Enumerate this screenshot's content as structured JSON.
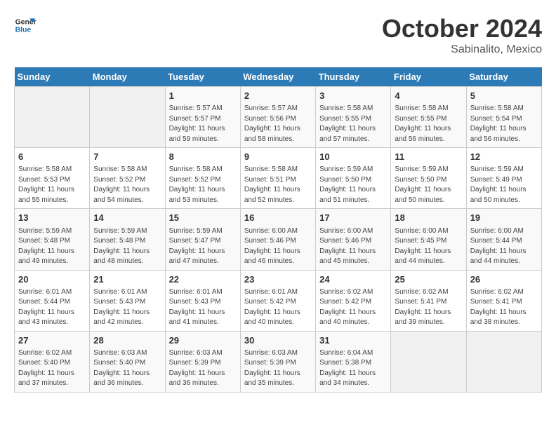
{
  "header": {
    "logo_line1": "General",
    "logo_line2": "Blue",
    "month": "October 2024",
    "location": "Sabinalito, Mexico"
  },
  "days_of_week": [
    "Sunday",
    "Monday",
    "Tuesday",
    "Wednesday",
    "Thursday",
    "Friday",
    "Saturday"
  ],
  "weeks": [
    [
      {
        "day": "",
        "info": ""
      },
      {
        "day": "",
        "info": ""
      },
      {
        "day": "1",
        "info": "Sunrise: 5:57 AM\nSunset: 5:57 PM\nDaylight: 11 hours and 59 minutes."
      },
      {
        "day": "2",
        "info": "Sunrise: 5:57 AM\nSunset: 5:56 PM\nDaylight: 11 hours and 58 minutes."
      },
      {
        "day": "3",
        "info": "Sunrise: 5:58 AM\nSunset: 5:55 PM\nDaylight: 11 hours and 57 minutes."
      },
      {
        "day": "4",
        "info": "Sunrise: 5:58 AM\nSunset: 5:55 PM\nDaylight: 11 hours and 56 minutes."
      },
      {
        "day": "5",
        "info": "Sunrise: 5:58 AM\nSunset: 5:54 PM\nDaylight: 11 hours and 56 minutes."
      }
    ],
    [
      {
        "day": "6",
        "info": "Sunrise: 5:58 AM\nSunset: 5:53 PM\nDaylight: 11 hours and 55 minutes."
      },
      {
        "day": "7",
        "info": "Sunrise: 5:58 AM\nSunset: 5:52 PM\nDaylight: 11 hours and 54 minutes."
      },
      {
        "day": "8",
        "info": "Sunrise: 5:58 AM\nSunset: 5:52 PM\nDaylight: 11 hours and 53 minutes."
      },
      {
        "day": "9",
        "info": "Sunrise: 5:58 AM\nSunset: 5:51 PM\nDaylight: 11 hours and 52 minutes."
      },
      {
        "day": "10",
        "info": "Sunrise: 5:59 AM\nSunset: 5:50 PM\nDaylight: 11 hours and 51 minutes."
      },
      {
        "day": "11",
        "info": "Sunrise: 5:59 AM\nSunset: 5:50 PM\nDaylight: 11 hours and 50 minutes."
      },
      {
        "day": "12",
        "info": "Sunrise: 5:59 AM\nSunset: 5:49 PM\nDaylight: 11 hours and 50 minutes."
      }
    ],
    [
      {
        "day": "13",
        "info": "Sunrise: 5:59 AM\nSunset: 5:48 PM\nDaylight: 11 hours and 49 minutes."
      },
      {
        "day": "14",
        "info": "Sunrise: 5:59 AM\nSunset: 5:48 PM\nDaylight: 11 hours and 48 minutes."
      },
      {
        "day": "15",
        "info": "Sunrise: 5:59 AM\nSunset: 5:47 PM\nDaylight: 11 hours and 47 minutes."
      },
      {
        "day": "16",
        "info": "Sunrise: 6:00 AM\nSunset: 5:46 PM\nDaylight: 11 hours and 46 minutes."
      },
      {
        "day": "17",
        "info": "Sunrise: 6:00 AM\nSunset: 5:46 PM\nDaylight: 11 hours and 45 minutes."
      },
      {
        "day": "18",
        "info": "Sunrise: 6:00 AM\nSunset: 5:45 PM\nDaylight: 11 hours and 44 minutes."
      },
      {
        "day": "19",
        "info": "Sunrise: 6:00 AM\nSunset: 5:44 PM\nDaylight: 11 hours and 44 minutes."
      }
    ],
    [
      {
        "day": "20",
        "info": "Sunrise: 6:01 AM\nSunset: 5:44 PM\nDaylight: 11 hours and 43 minutes."
      },
      {
        "day": "21",
        "info": "Sunrise: 6:01 AM\nSunset: 5:43 PM\nDaylight: 11 hours and 42 minutes."
      },
      {
        "day": "22",
        "info": "Sunrise: 6:01 AM\nSunset: 5:43 PM\nDaylight: 11 hours and 41 minutes."
      },
      {
        "day": "23",
        "info": "Sunrise: 6:01 AM\nSunset: 5:42 PM\nDaylight: 11 hours and 40 minutes."
      },
      {
        "day": "24",
        "info": "Sunrise: 6:02 AM\nSunset: 5:42 PM\nDaylight: 11 hours and 40 minutes."
      },
      {
        "day": "25",
        "info": "Sunrise: 6:02 AM\nSunset: 5:41 PM\nDaylight: 11 hours and 39 minutes."
      },
      {
        "day": "26",
        "info": "Sunrise: 6:02 AM\nSunset: 5:41 PM\nDaylight: 11 hours and 38 minutes."
      }
    ],
    [
      {
        "day": "27",
        "info": "Sunrise: 6:02 AM\nSunset: 5:40 PM\nDaylight: 11 hours and 37 minutes."
      },
      {
        "day": "28",
        "info": "Sunrise: 6:03 AM\nSunset: 5:40 PM\nDaylight: 11 hours and 36 minutes."
      },
      {
        "day": "29",
        "info": "Sunrise: 6:03 AM\nSunset: 5:39 PM\nDaylight: 11 hours and 36 minutes."
      },
      {
        "day": "30",
        "info": "Sunrise: 6:03 AM\nSunset: 5:39 PM\nDaylight: 11 hours and 35 minutes."
      },
      {
        "day": "31",
        "info": "Sunrise: 6:04 AM\nSunset: 5:38 PM\nDaylight: 11 hours and 34 minutes."
      },
      {
        "day": "",
        "info": ""
      },
      {
        "day": "",
        "info": ""
      }
    ]
  ]
}
